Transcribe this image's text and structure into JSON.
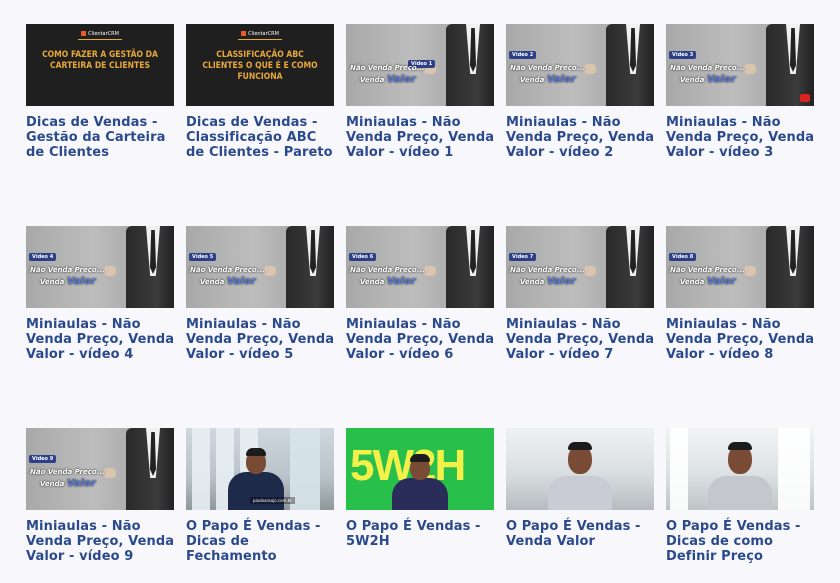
{
  "videos": [
    {
      "title": "Dicas de Vendas - Gestão da Carteira de Clientes",
      "thumb_text": "COMO FAZER A GESTÃO DA CARTEIRA DE CLIENTES"
    },
    {
      "title": "Dicas de Vendas - Classificação ABC de Clientes - Pareto",
      "thumb_text": "CLASSIFICAÇÃO ABC CLIENTES O QUE É E COMO FUNCIONA"
    },
    {
      "title": "Miniaulas - Não Venda Preço, Venda Valor - vídeo 1",
      "badge": "Vídeo 1"
    },
    {
      "title": "Miniaulas - Não Venda Preço, Venda Valor - vídeo 2",
      "badge": "Vídeo 2"
    },
    {
      "title": "Miniaulas - Não Venda Preço, Venda Valor - vídeo 3",
      "badge": "Vídeo 3"
    },
    {
      "title": "Miniaulas - Não Venda Preço, Venda Valor - vídeo 4",
      "badge": "Vídeo 4"
    },
    {
      "title": "Miniaulas - Não Venda Preço, Venda Valor - vídeo 5",
      "badge": "Vídeo 5"
    },
    {
      "title": "Miniaulas - Não Venda Preço, Venda Valor - vídeo 6",
      "badge": "Vídeo 6"
    },
    {
      "title": "Miniaulas - Não Venda Preço, Venda Valor - vídeo 7",
      "badge": "Vídeo 7"
    },
    {
      "title": "Miniaulas - Não Venda Preço, Venda Valor - vídeo 8",
      "badge": "Vídeo 8"
    },
    {
      "title": "Miniaulas - Não Venda Preço, Venda Valor - vídeo 9",
      "badge": "Vídeo 9"
    },
    {
      "title": "O Papo É Vendas - Dicas de Fechamento",
      "caption": "pauloaraujo.com.br"
    },
    {
      "title": "O Papo É Vendas - 5W2H",
      "thumb_text": "5W2H"
    },
    {
      "title": "O Papo É Vendas - Venda Valor"
    },
    {
      "title": "O Papo É Vendas - Dicas de como Definir Preço"
    }
  ],
  "thumb_common": {
    "logo": "ClientarCRM",
    "nvp_line1": "Não Venda Preço...",
    "nvp_line2_prefix": "Venda ",
    "nvp_line2_emph": "Valor"
  },
  "colors": {
    "title": "#2b4a8c",
    "background": "#f8f8fc"
  }
}
